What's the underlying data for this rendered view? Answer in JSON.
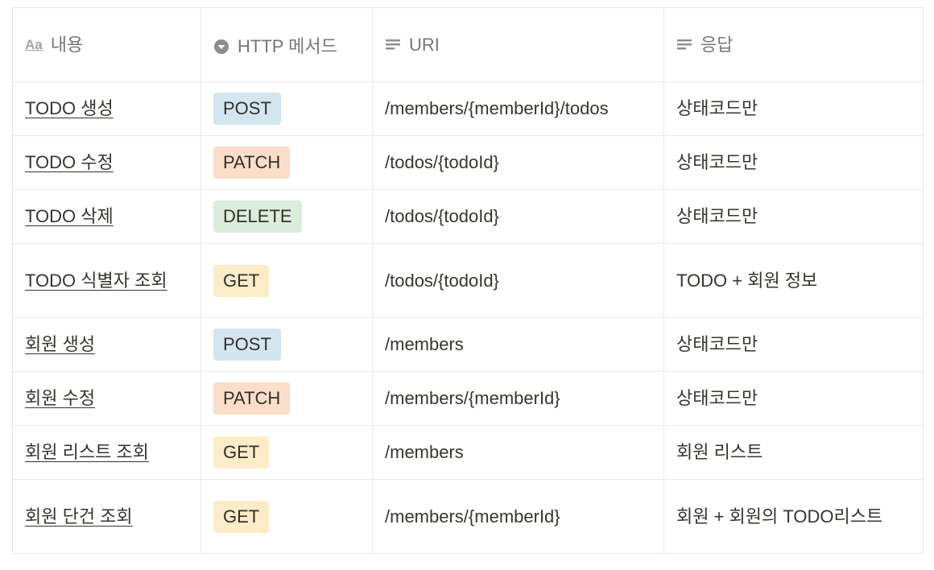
{
  "colors": {
    "tag_post": "#d3e5ef",
    "tag_patch": "#fadec9",
    "tag_delete": "#dbeddb",
    "tag_get": "#fdecc8"
  },
  "header": {
    "name_label": "내용",
    "method_label": "HTTP 메서드",
    "uri_label": "URI",
    "response_label": "응답",
    "name_icon": "Aa",
    "method_icon": "select-icon",
    "uri_icon": "text-lines-icon",
    "response_icon": "text-lines-icon"
  },
  "rows": [
    {
      "name": "TODO 생성",
      "method": "POST",
      "uri": "/members/{memberId}/todos",
      "response": "상태코드만"
    },
    {
      "name": "TODO 수정",
      "method": "PATCH",
      "uri": "/todos/{todoId}",
      "response": "상태코드만"
    },
    {
      "name": "TODO 삭제",
      "method": "DELETE",
      "uri": "/todos/{todoId}",
      "response": "상태코드만"
    },
    {
      "name": "TODO 식별자 조회",
      "method": "GET",
      "uri": "/todos/{todoId}",
      "response": "TODO + 회원 정보"
    },
    {
      "name": "회원 생성",
      "method": "POST",
      "uri": "/members",
      "response": "상태코드만"
    },
    {
      "name": "회원 수정",
      "method": "PATCH",
      "uri": "/members/{memberId}",
      "response": "상태코드만"
    },
    {
      "name": "회원 리스트 조회",
      "method": "GET",
      "uri": "/members",
      "response": "회원 리스트"
    },
    {
      "name": "회원 단건 조회",
      "method": "GET",
      "uri": "/members/{memberId}",
      "response": "회원 + 회원의 TODO리스트"
    }
  ]
}
